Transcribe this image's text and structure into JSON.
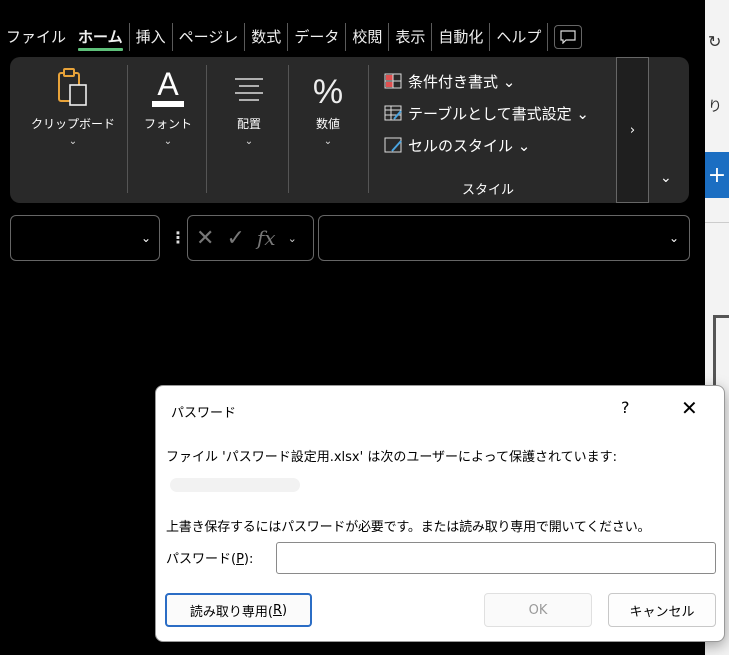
{
  "tabs": [
    {
      "label": "ファイル"
    },
    {
      "label": "ホーム"
    },
    {
      "label": "挿入"
    },
    {
      "label": "ページレ"
    },
    {
      "label": "数式"
    },
    {
      "label": "データ"
    },
    {
      "label": "校閲"
    },
    {
      "label": "表示"
    },
    {
      "label": "自動化"
    },
    {
      "label": "ヘルプ"
    }
  ],
  "ribbon": {
    "clipboard": {
      "label": "クリップボード"
    },
    "font": {
      "label": "フォント"
    },
    "align": {
      "label": "配置"
    },
    "number": {
      "label": "数値"
    },
    "styles": {
      "conditional": "条件付き書式 ⌄",
      "table": "テーブルとして書式設定 ⌄",
      "cell": "セルのスタイル ⌄",
      "caption": "スタイル"
    },
    "more": "›",
    "collapse": "⌄"
  },
  "formula_bar": {
    "name_box": "",
    "formula": ""
  },
  "right_window": {
    "text": "り",
    "plus": "+"
  },
  "dialog": {
    "title": "パスワード",
    "help": "?",
    "close": "✕",
    "message1": "ファイル 'パスワード設定用.xlsx' は次のユーザーによって保護されています:",
    "message2": "上書き保存するにはパスワードが必要です。または読み取り専用で開いてください。",
    "password_label": "パスワード(",
    "password_mnemonic": "P",
    "password_label_end": "):",
    "password_value": "",
    "readonly_button": "読み取り専用(",
    "readonly_mnemonic": "R",
    "readonly_button_end": ")",
    "ok_button": "OK",
    "cancel_button": "キャンセル"
  }
}
